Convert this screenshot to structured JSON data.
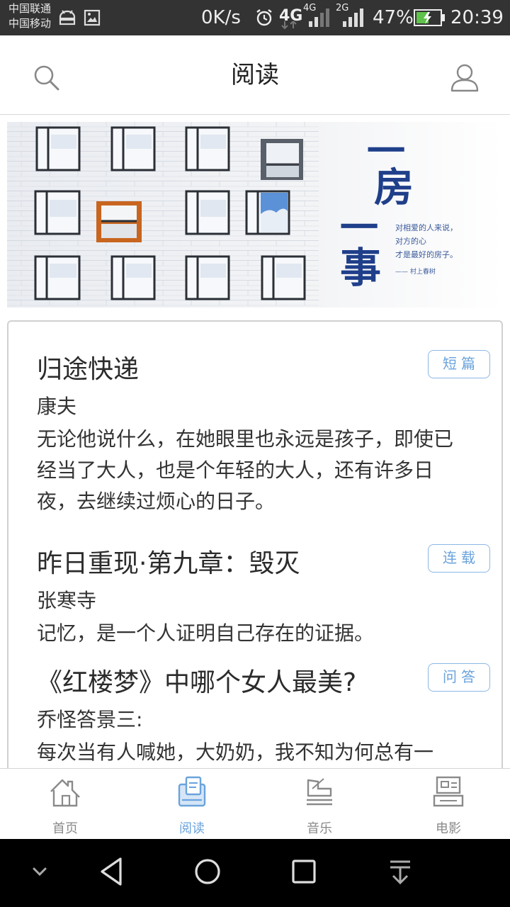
{
  "status_bar": {
    "carrier_1": "中国联通",
    "carrier_2": "中国移动",
    "net_speed": "0K/s",
    "network_4g": "4G",
    "network_4g_small": "4G",
    "network_2g": "2G",
    "battery": "47%",
    "time": "20:39"
  },
  "header": {
    "title": "阅读"
  },
  "banner": {
    "title_glyph_1": "一",
    "title_glyph_2": "房",
    "title_glyph_3": "一",
    "title_glyph_4": "事",
    "quote_line_1": "对相爱的人来说，",
    "quote_line_2": "对方的心",
    "quote_line_3": "才是最好的房子。",
    "quote_author": "—— 村上春树"
  },
  "articles": [
    {
      "title": "归途快递",
      "tag": "短篇",
      "author": "康夫",
      "summary": "无论他说什么，在她眼里也永远是孩子，即使已经当了大人，也是个年轻的大人，还有许多日夜，去继续过烦心的日子。"
    },
    {
      "title": "昨日重现·第九章：毁灭",
      "tag": "连载",
      "author": "张寒寺",
      "summary": "记忆，是一个人证明自己存在的证据。"
    },
    {
      "title": "《红楼梦》中哪个女人最美?",
      "tag": "问答",
      "author": "乔怪答景三:",
      "summary": "每次当有人喊她，大奶奶，我不知为何总有一"
    }
  ],
  "bottom_nav": [
    {
      "label": "首页",
      "icon": "home-icon",
      "active": false
    },
    {
      "label": "阅读",
      "icon": "reading-icon",
      "active": true
    },
    {
      "label": "音乐",
      "icon": "music-icon",
      "active": false
    },
    {
      "label": "电影",
      "icon": "movie-icon",
      "active": false
    }
  ],
  "colors": {
    "accent": "#6aa3dc",
    "status_bar_bg": "#333333",
    "banner_title": "#1f3f8a"
  }
}
